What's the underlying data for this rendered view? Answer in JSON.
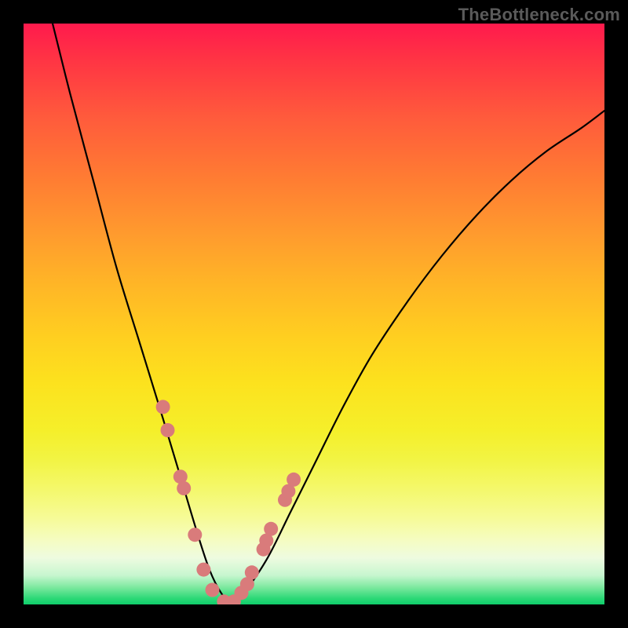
{
  "watermark": "TheBottleneck.com",
  "chart_data": {
    "type": "line",
    "title": "",
    "xlabel": "",
    "ylabel": "",
    "xlim": [
      0,
      100
    ],
    "ylim": [
      0,
      100
    ],
    "grid": false,
    "series": [
      {
        "name": "bottleneck-curve",
        "x": [
          5,
          8,
          12,
          16,
          20,
          24,
          27,
          30,
          32,
          34,
          36,
          38,
          42,
          46,
          50,
          55,
          60,
          66,
          72,
          78,
          84,
          90,
          96,
          100
        ],
        "y": [
          100,
          88,
          73,
          58,
          45,
          32,
          22,
          12,
          6,
          2,
          0,
          2,
          8,
          16,
          24,
          34,
          43,
          52,
          60,
          67,
          73,
          78,
          82,
          85
        ]
      }
    ],
    "markers": {
      "name": "highlight-dots",
      "x": [
        24.0,
        24.8,
        27.0,
        27.6,
        29.5,
        31.0,
        32.5,
        34.5,
        36.2,
        37.5,
        38.5,
        39.3,
        41.3,
        41.8,
        42.6,
        45.0,
        45.6,
        46.5
      ],
      "y": [
        34.0,
        30.0,
        22.0,
        20.0,
        12.0,
        6.0,
        2.5,
        0.5,
        0.5,
        2.0,
        3.5,
        5.5,
        9.5,
        11.0,
        13.0,
        18.0,
        19.5,
        21.5
      ]
    },
    "background": {
      "type": "vertical-gradient",
      "stops": [
        {
          "pos": 0,
          "color": "#ff1a4d"
        },
        {
          "pos": 50,
          "color": "#ffcf20"
        },
        {
          "pos": 80,
          "color": "#f6fb96"
        },
        {
          "pos": 100,
          "color": "#0fce6b"
        }
      ]
    }
  }
}
